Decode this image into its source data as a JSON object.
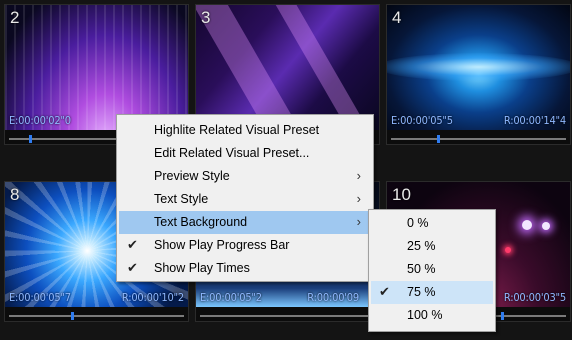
{
  "tiles": [
    {
      "number": "2",
      "elapsed": "E:00:00'02\"0",
      "remaining": "",
      "progress": 0.12
    },
    {
      "number": "3",
      "elapsed": "",
      "remaining": "",
      "progress": 0.0
    },
    {
      "number": "4",
      "elapsed": "E:00:00'05\"5",
      "remaining": "R:00:00'14\"4",
      "progress": 0.27
    },
    {
      "number": "8",
      "elapsed": "E:00:00'05\"7",
      "remaining": "R:00:00'10\"2",
      "progress": 0.36
    },
    {
      "number": "",
      "elapsed": "E:00:00'05\"2",
      "remaining": "R:00:00'09",
      "progress": 0.0
    },
    {
      "number": "10",
      "elapsed": "",
      "remaining": "R:00:00'03\"5",
      "progress": 0.6
    }
  ],
  "context_menu": {
    "items": [
      {
        "label": "Highlite Related Visual Preset",
        "checked": false,
        "submenu": false
      },
      {
        "label": "Edit Related Visual Preset...",
        "checked": false,
        "submenu": false
      },
      {
        "label": "Preview Style",
        "checked": false,
        "submenu": true
      },
      {
        "label": "Text Style",
        "checked": false,
        "submenu": true
      },
      {
        "label": "Text Background",
        "checked": false,
        "submenu": true,
        "highlighted": true
      },
      {
        "label": "Show Play Progress Bar",
        "checked": true,
        "submenu": false
      },
      {
        "label": "Show Play Times",
        "checked": true,
        "submenu": false
      }
    ]
  },
  "text_background_submenu": {
    "items": [
      {
        "label": "0 %",
        "checked": false
      },
      {
        "label": "25 %",
        "checked": false
      },
      {
        "label": "50 %",
        "checked": false
      },
      {
        "label": "75 %",
        "checked": true
      },
      {
        "label": "100 %",
        "checked": false
      }
    ]
  },
  "glyphs": {
    "check": "✔",
    "arrow": "›"
  },
  "colors": {
    "highlight": "#9fc8f0",
    "submenu_hover": "#cde4f8",
    "timecode": "#8fb8ff",
    "progress_knob": "#2f7cf0"
  }
}
